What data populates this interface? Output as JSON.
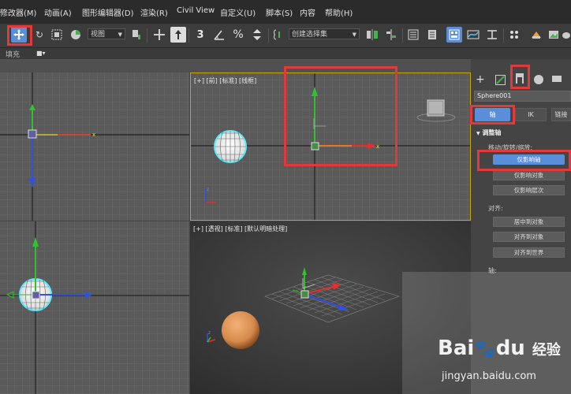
{
  "menubar": {
    "items": [
      {
        "label": "修改器(M)"
      },
      {
        "label": "动画(A)"
      },
      {
        "label": "图形编辑器(D)"
      },
      {
        "label": "渲染(R)"
      },
      {
        "label": "Civil View"
      },
      {
        "label": "自定义(U)"
      },
      {
        "label": "脚本(S)"
      },
      {
        "label": "内容"
      },
      {
        "label": "帮助(H)"
      }
    ]
  },
  "toolbar": {
    "view_dropdown": "视图",
    "selection_set_placeholder": "创建选择集",
    "snap_value": "3",
    "percent_label": "%"
  },
  "ribbon": {
    "label": "填充"
  },
  "viewports": {
    "top_right_label": "[+] [前] [标准] [线框]",
    "bottom_right_label": "[+] [透视] [标准] [默认明暗处理]"
  },
  "panel": {
    "object_name": "Sphere001",
    "tabs": {
      "pivot": "轴",
      "ik": "IK",
      "link": "链接"
    },
    "adjust_pivot": {
      "title": "调整轴",
      "move_rotate_scale": "移动/旋转/缩放:",
      "affect_pivot_only": "仅影响轴",
      "affect_object_only": "仅影响对象",
      "affect_hierarchy_only": "仅影响层次",
      "align_label": "对齐:",
      "center_to_object": "居中到对象",
      "align_to_object": "对齐到对象",
      "align_to_world": "对齐到世界",
      "pivot_label": "轴:"
    }
  },
  "watermark": {
    "brand_a": "Bai",
    "brand_b": "du",
    "jingyan": "经验",
    "url": "jingyan.baidu.com"
  },
  "colors": {
    "highlight_box": "#e23a3a",
    "selected_button": "#5a8ed8",
    "axis_x": "#e03030",
    "axis_y": "#30c030",
    "axis_z": "#3050e0",
    "selection_outline": "#55eeff",
    "viewport_active_border": "#c8a800",
    "sphere_orange": "#d68a4a"
  }
}
